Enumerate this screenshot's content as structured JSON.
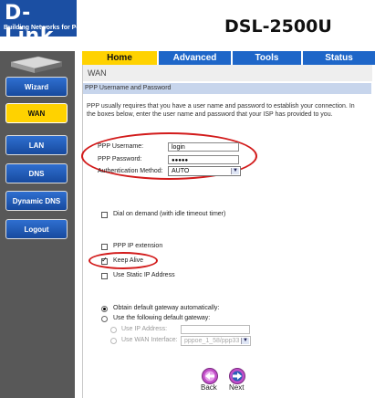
{
  "brand": {
    "logo": "D-Link",
    "tagline": "Building Networks for People",
    "model": "DSL-2500U"
  },
  "sidebar": {
    "items": [
      {
        "label": "Wizard",
        "active": false
      },
      {
        "label": "WAN",
        "active": true
      },
      {
        "label": "LAN",
        "active": false
      },
      {
        "label": "DNS",
        "active": false
      },
      {
        "label": "Dynamic DNS",
        "active": false
      },
      {
        "label": "Logout",
        "active": false
      }
    ]
  },
  "tabs": [
    {
      "label": "Home",
      "active": true
    },
    {
      "label": "Advanced",
      "active": false
    },
    {
      "label": "Tools",
      "active": false
    },
    {
      "label": "Status",
      "active": false
    }
  ],
  "page": {
    "title": "WAN",
    "section": "PPP Username and Password",
    "intro": "PPP usually requires that you have a user name and password to establish your connection. In the boxes below, enter the user name and password that your ISP has provided to you."
  },
  "form": {
    "username_label": "PPP Username:",
    "username_value": "login",
    "password_label": "PPP Password:",
    "password_value": "●●●●●",
    "auth_label": "Authentication Method:",
    "auth_value": "AUTO",
    "dial_on_demand": "Dial on demand (with idle timeout timer)",
    "ip_extension": "PPP IP extension",
    "keep_alive": "Keep Alive",
    "static_ip": "Use Static IP Address",
    "gw_auto": "Obtain default gateway automatically:",
    "gw_manual": "Use the following default gateway:",
    "use_ip_label": "Use IP Address:",
    "use_wan_label": "Use WAN Interface:",
    "wan_interface_value": "pppoe_1_58/ppp33"
  },
  "buttons": {
    "back": "Back",
    "next": "Next"
  },
  "colors": {
    "brand_blue": "#1b4fa3",
    "active_yellow": "#ffd200",
    "tab_blue": "#1e66c8",
    "annotation_red": "#d21b1b"
  }
}
